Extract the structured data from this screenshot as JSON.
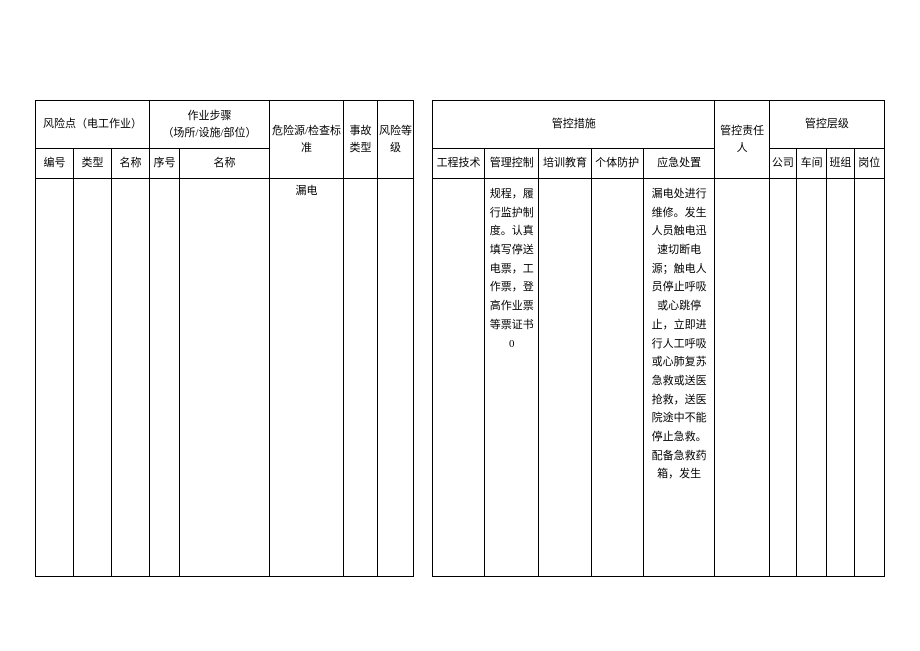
{
  "leftHeader": {
    "riskPoint": "风险点（电工作业）",
    "workStep": "作业步骤\n（场所/设施/部位）",
    "hazardStandard": "危险源/检查标准",
    "accidentType": "事故类型",
    "riskLevel": "风险等级",
    "numberLabel": "编号",
    "typeLabel": "类型",
    "nameLabel": "名称",
    "seqLabel": "序号",
    "nameLabel2": "名称"
  },
  "rightHeader": {
    "controlMeasures": "管控措施",
    "controlPerson": "管控责任人",
    "controlLevel": "管控层级",
    "engineering": "工程技术",
    "management": "管理控制",
    "training": "培训教育",
    "protection": "个体防护",
    "emergency": "应急处置",
    "company": "公司",
    "workshop": "车间",
    "team": "班组",
    "post": "岗位"
  },
  "bodyLeft": {
    "hazardText": "漏电"
  },
  "bodyRight": {
    "managementText": "规程，履行监护制度。认真填写停送电票，工作票，登高作业票等票证书\n0",
    "emergencyText": "漏电处进行维修。发生人员触电迅速切断电源；触电人员停止呼吸或心跳停止，立即进行人工呼吸或心肺复苏急救或送医抢救，送医院途中不能停止急救。配备急救药箱，发生"
  }
}
